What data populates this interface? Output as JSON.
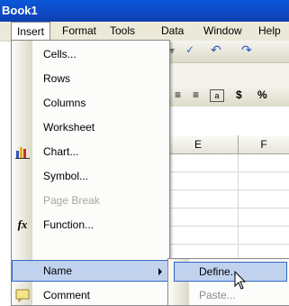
{
  "window": {
    "title": "Book1"
  },
  "menubar": {
    "items": [
      {
        "label": "Insert",
        "active": true
      },
      {
        "label": "Format"
      },
      {
        "label": "Tools"
      },
      {
        "label": "Data"
      },
      {
        "label": "Window"
      },
      {
        "label": "Help"
      }
    ]
  },
  "insert_menu": {
    "items": [
      {
        "label": "Cells...",
        "icon": null
      },
      {
        "label": "Rows",
        "icon": null
      },
      {
        "label": "Columns",
        "icon": null
      },
      {
        "label": "Worksheet",
        "icon": null
      },
      {
        "label": "Chart...",
        "icon": "chart-icon"
      },
      {
        "label": "Symbol...",
        "icon": null
      },
      {
        "label": "Page Break",
        "icon": null,
        "disabled": true
      },
      {
        "label": "Function...",
        "icon": "function-icon"
      },
      {
        "label": "Name",
        "icon": null,
        "highlighted": true,
        "submenu": true
      },
      {
        "label": "Comment",
        "icon": "comment-icon"
      }
    ]
  },
  "name_submenu": {
    "items": [
      {
        "label": "Define...",
        "highlighted": true
      },
      {
        "label": "Paste..."
      }
    ]
  },
  "toolbar": {
    "currency_symbol": "$",
    "percent_symbol": "%"
  },
  "grid": {
    "columns": [
      "E",
      "F"
    ]
  },
  "colors": {
    "title_bar": "#0f49c4",
    "highlight": "#c1d2ee",
    "highlight_border": "#316ac5"
  }
}
